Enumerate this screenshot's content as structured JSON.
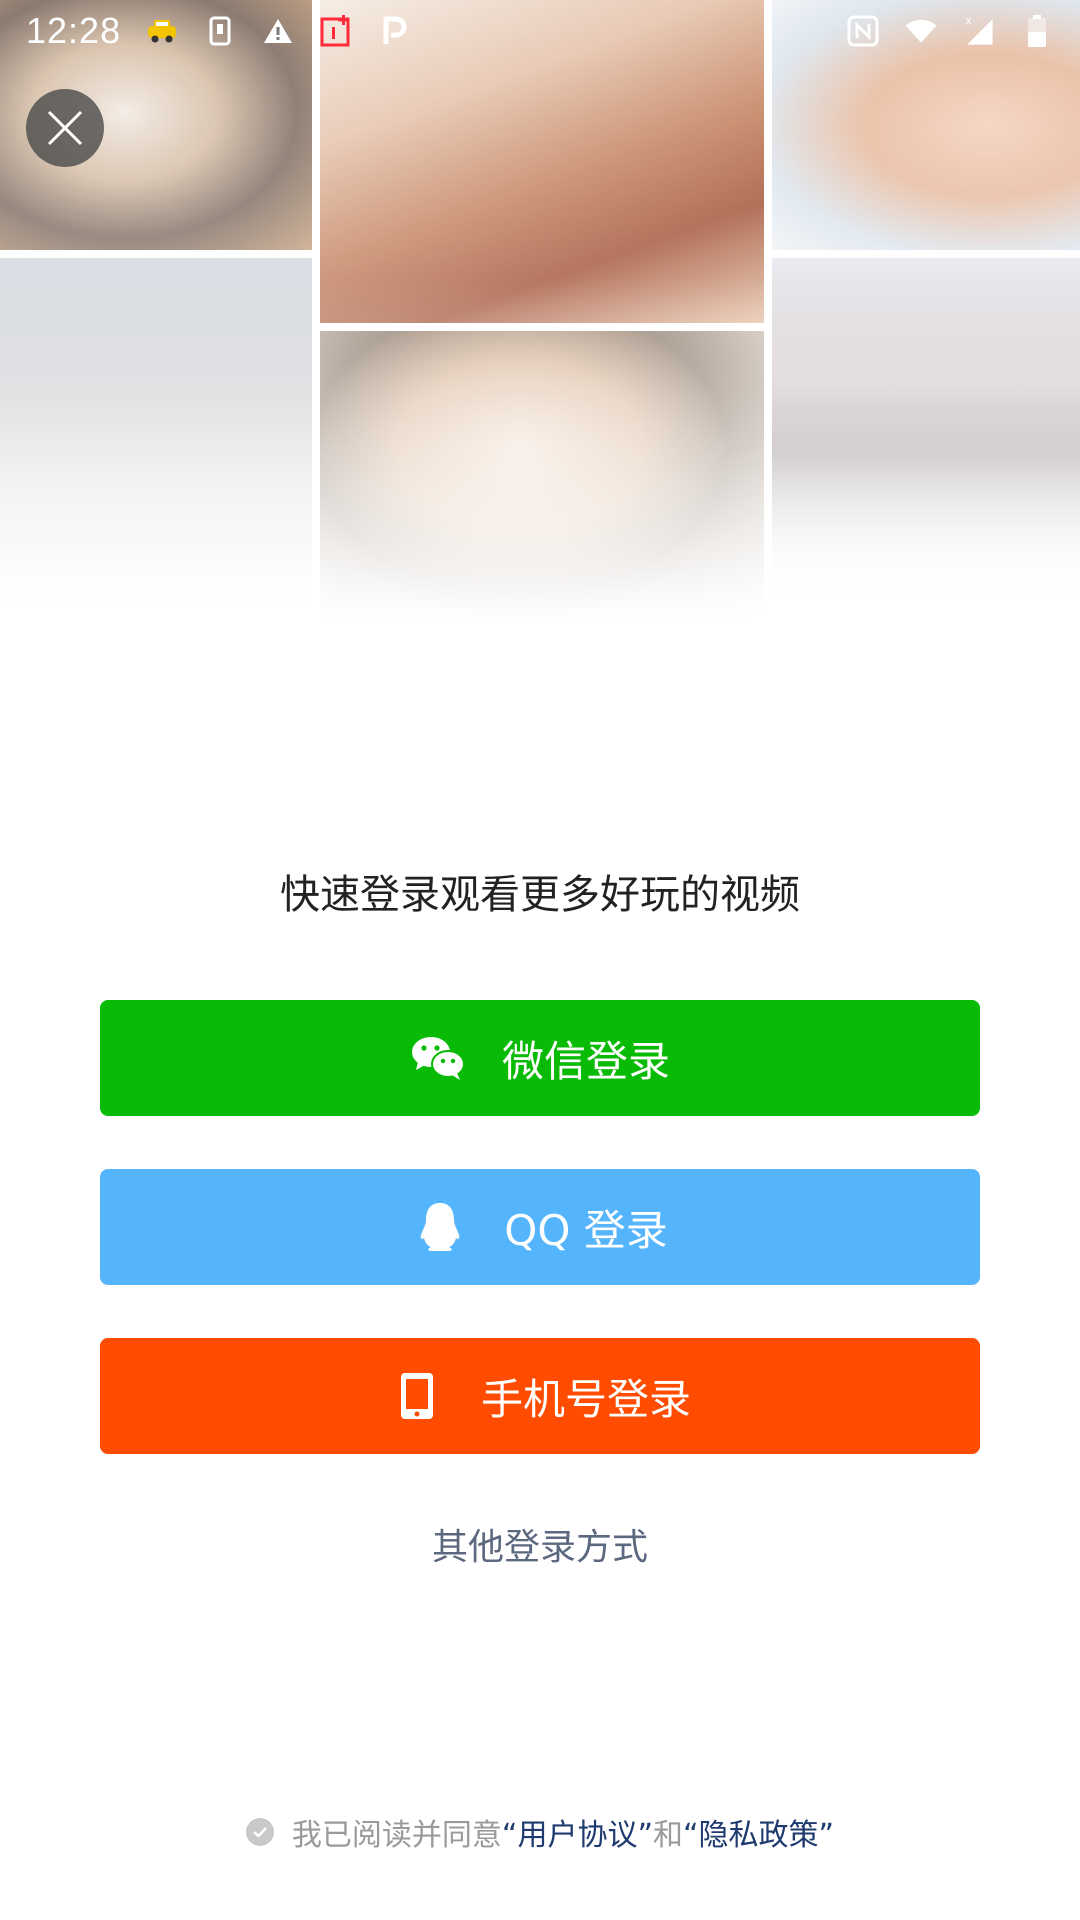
{
  "status_bar": {
    "time": "12:28",
    "left_icons": [
      "taxi-icon",
      "sim-card-icon",
      "warning-icon",
      "oneplus-icon",
      "parking-icon"
    ],
    "right_icons": [
      "nfc-icon",
      "wifi-icon",
      "signal-icon",
      "battery-icon"
    ]
  },
  "collage": {
    "tiles": [
      "cat",
      "woman",
      "baby",
      "archer",
      "man",
      "skier"
    ]
  },
  "prompt": "快速登录观看更多好玩的视频",
  "buttons": {
    "wechat": {
      "label": "微信登录",
      "color": "#09bb07",
      "icon": "wechat-icon"
    },
    "qq": {
      "label": "QQ 登录",
      "color": "#55b5fc",
      "icon": "qq-penguin-icon"
    },
    "phone": {
      "label": "手机号登录",
      "color": "#ff4c00",
      "icon": "phone-icon"
    }
  },
  "other_login": "其他登录方式",
  "agreement": {
    "prefix": "我已阅读并同意",
    "user_agreement": "“用户协议”",
    "conjunction": "和",
    "privacy_policy": "“隐私政策”"
  }
}
